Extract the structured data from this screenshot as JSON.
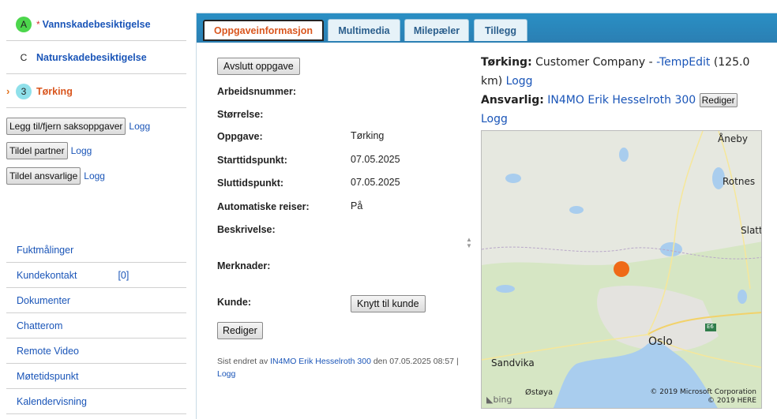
{
  "workflow": [
    {
      "badge": "A",
      "star": "*",
      "label": "Vannskadebesiktigelse"
    },
    {
      "badge": "C",
      "star": "",
      "label": "Naturskadebesiktigelse"
    },
    {
      "badge": "3",
      "star": "",
      "label": "Tørking",
      "marker": "›"
    }
  ],
  "side_actions": [
    {
      "button": "Legg til/fjern saksoppgaver",
      "link": "Logg"
    },
    {
      "button": "Tildel partner",
      "link": "Logg"
    },
    {
      "button": "Tildel ansvarlige",
      "link": "Logg"
    }
  ],
  "side_links": [
    {
      "label": "Fuktmålinger",
      "count": ""
    },
    {
      "label": "Kundekontakt",
      "count": "[0]"
    },
    {
      "label": "Dokumenter",
      "count": ""
    },
    {
      "label": "Chatterom",
      "count": ""
    },
    {
      "label": "Remote Video",
      "count": ""
    },
    {
      "label": "Møtetidspunkt",
      "count": ""
    },
    {
      "label": "Kalendervisning",
      "count": ""
    }
  ],
  "tabs": [
    "Oppgaveinformasjon",
    "Multimedia",
    "Milepæler",
    "Tillegg"
  ],
  "active_tab": "Oppgaveinformasjon",
  "task": {
    "end_button": "Avslutt oppgave",
    "fields": [
      {
        "label": "Arbeidsnummer:",
        "value": ""
      },
      {
        "label": "Størrelse:",
        "value": ""
      },
      {
        "label": "Oppgave:",
        "value": "Tørking"
      },
      {
        "label": "Starttidspunkt:",
        "value": "07.05.2025"
      },
      {
        "label": "Sluttidspunkt:",
        "value": "07.05.2025"
      },
      {
        "label": "Automatiske reiser:",
        "value": "På"
      },
      {
        "label": "Beskrivelse:",
        "value": ""
      },
      {
        "label": "Merknader:",
        "value": ""
      },
      {
        "label": "Kunde:",
        "value": ""
      }
    ],
    "link_customer_button": "Knytt til kunde",
    "edit_button": "Rediger",
    "footer_prefix": "Sist endret av",
    "footer_user": "IN4MO Erik Hesselroth 300",
    "footer_date": "den 07.05.2025 08:57 |",
    "footer_log": "Logg"
  },
  "info": {
    "heading": "Tørking:",
    "company": "Customer Company -",
    "temp_link": "-TempEdit",
    "size": "(125.0",
    "size_unit": "km)",
    "log1": "Logg",
    "responsible_label": "Ansvarlig:",
    "responsible_user": "IN4MO Erik Hesselroth 300",
    "edit_button": "Rediger",
    "log2": "Logg"
  },
  "map": {
    "labels": [
      "Åneby",
      "Rotnes",
      "Slatt",
      "Oslo",
      "Sandvika",
      "Østøya",
      "E6"
    ],
    "copyright1": "© 2019 Microsoft Corporation",
    "copyright2": "© 2019 HERE",
    "brand": "bing",
    "marker_color": "#ef6a17"
  },
  "colors": {
    "tabbar": "#2a8fc4",
    "link": "#1a55b8",
    "accent": "#d9561e"
  }
}
